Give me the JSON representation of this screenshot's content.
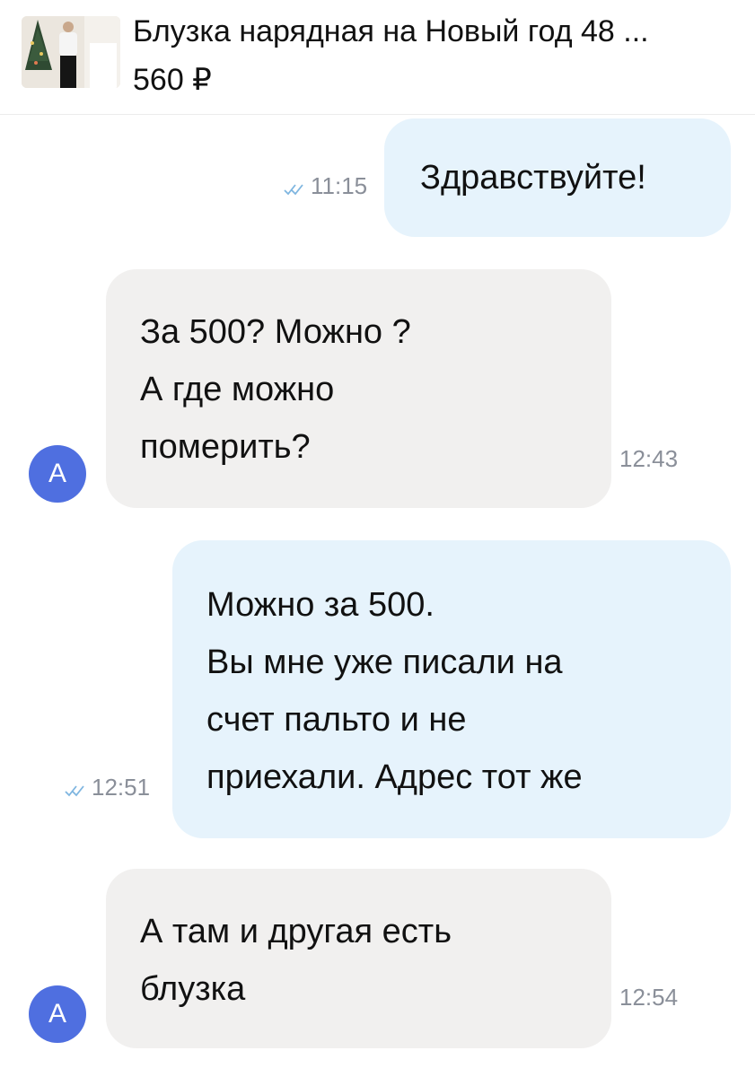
{
  "header": {
    "product_title": "Блузка нарядная на Новый год 48 ...",
    "product_price": "560 ₽"
  },
  "messages": [
    {
      "direction": "out",
      "lines": [
        "Здравствуйте!"
      ],
      "time": "11:15",
      "status_icon": "double-check-icon"
    },
    {
      "direction": "in",
      "lines": [
        "За 500? Можно ?",
        "А где можно",
        "померить?"
      ],
      "time": "12:43",
      "avatar_letter": "А"
    },
    {
      "direction": "out",
      "lines": [
        "Можно за 500.",
        "Вы мне уже писали на",
        "счет пальто и не",
        "приехали. Адрес тот же"
      ],
      "time": "12:51",
      "status_icon": "double-check-icon"
    },
    {
      "direction": "in",
      "lines": [
        "А там и другая есть",
        "блузка"
      ],
      "time": "12:54",
      "avatar_letter": "А"
    }
  ],
  "colors": {
    "outgoing_bubble": "#e6f3fc",
    "incoming_bubble": "#f1f0ef",
    "avatar": "#4f6fe0",
    "read_check": "#7fb6e0"
  }
}
